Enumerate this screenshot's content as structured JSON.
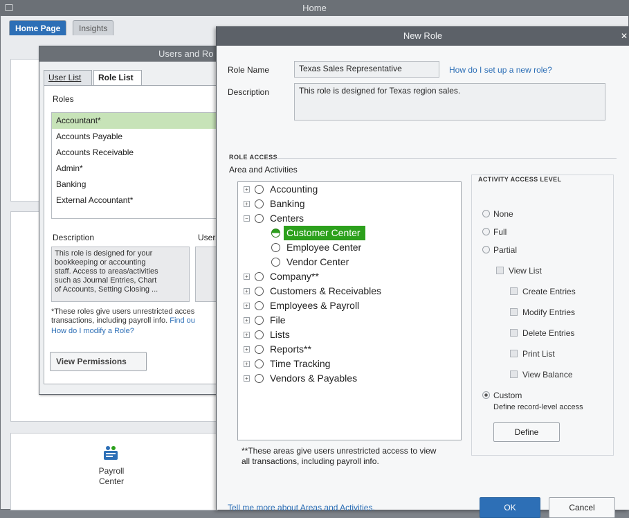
{
  "home": {
    "title": "Home",
    "tabs": [
      {
        "label": "Home Page"
      },
      {
        "label": "Insights"
      }
    ],
    "payroll_label_line1": "Payroll",
    "payroll_label_line2": "Center"
  },
  "users_roles": {
    "title": "Users and Ro",
    "tabs": [
      {
        "label": "User List"
      },
      {
        "label": "Role List"
      }
    ],
    "roles_label": "Roles",
    "roles": [
      {
        "label": "Accountant*"
      },
      {
        "label": "Accounts Payable"
      },
      {
        "label": "Accounts Receivable"
      },
      {
        "label": "Admin*"
      },
      {
        "label": "Banking"
      },
      {
        "label": "External Accountant*"
      }
    ],
    "description_label": "Description",
    "users_label": "Users",
    "description_lines": [
      "This role is designed for your",
      "bookkeeping or accounting",
      "staff. Access to areas/activities",
      "such as Journal Entries, Chart",
      "of Accounts, Setting Closing ..."
    ],
    "note_line1": "*These roles give users unrestricted acces",
    "note_line2": "transactions, including payroll info.",
    "note_link": "Find ou",
    "modify_link": "How do I modify a Role?",
    "view_permissions_button": "View Permissions"
  },
  "new_role": {
    "title": "New Role",
    "close_glyph": "✕",
    "role_name_label": "Role Name",
    "role_name_value": "Texas Sales Representative",
    "help_link": "How do I set up a new role?",
    "description_label": "Description",
    "description_value": "This role is designed for Texas region sales.",
    "role_access_title": "ROLE ACCESS",
    "areas_label": "Area and Activities",
    "tree": [
      {
        "label": "Accounting"
      },
      {
        "label": "Banking"
      },
      {
        "label": "Centers"
      },
      {
        "label": "Customer Center"
      },
      {
        "label": "Employee Center"
      },
      {
        "label": "Vendor Center"
      },
      {
        "label": "Company**"
      },
      {
        "label": "Customers & Receivables"
      },
      {
        "label": "Employees & Payroll"
      },
      {
        "label": "File"
      },
      {
        "label": "Lists"
      },
      {
        "label": "Reports**"
      },
      {
        "label": "Time Tracking"
      },
      {
        "label": "Vendors & Payables"
      }
    ],
    "tree_note_line1": "**These areas give users unrestricted access to view",
    "tree_note_line2": "all transactions, including payroll info.",
    "access_level": {
      "title": "ACTIVITY ACCESS LEVEL",
      "none": "None",
      "full": "Full",
      "partial": "Partial",
      "view_list": "View List",
      "create_entries": "Create Entries",
      "modify_entries": "Modify Entries",
      "delete_entries": "Delete Entries",
      "print_list": "Print List",
      "view_balance": "View Balance",
      "custom": "Custom",
      "custom_desc": "Define record-level access",
      "define_button": "Define"
    },
    "tell_more_link": "Tell me more about Areas and Activities.",
    "ok_button": "OK",
    "cancel_button": "Cancel"
  },
  "colors": {
    "accent_blue": "#2d6fb6",
    "selected_green": "#2ca01c",
    "list_selection": "#c7e3b8",
    "titlebar": "#5c6168"
  }
}
